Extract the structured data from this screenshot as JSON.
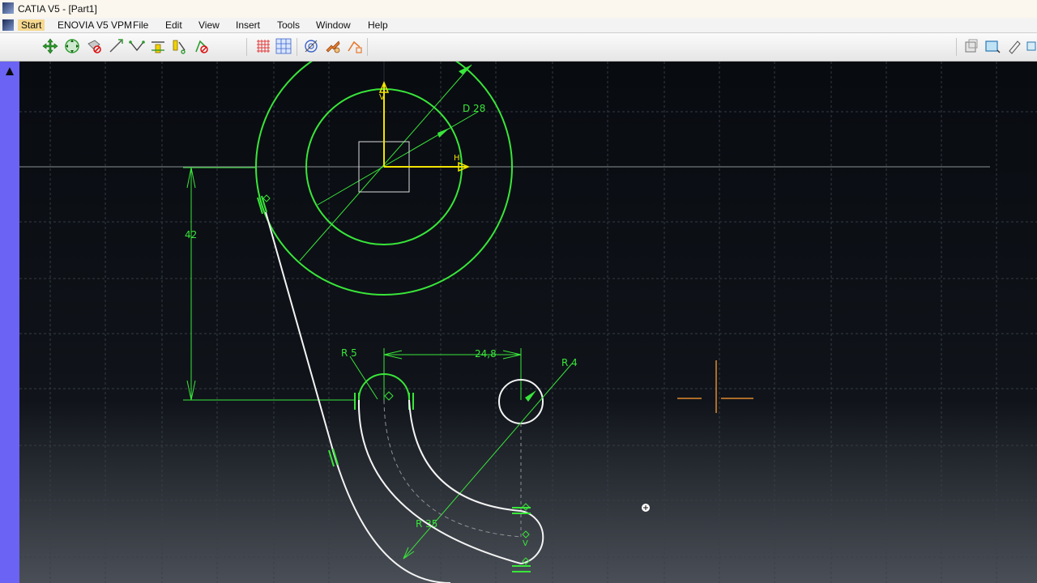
{
  "window": {
    "title": "CATIA V5 - [Part1]"
  },
  "menu": [
    {
      "label": "Start",
      "active": true
    },
    {
      "label": "ENOVIA V5 VPM"
    },
    {
      "label": "File"
    },
    {
      "label": "Edit"
    },
    {
      "label": "View"
    },
    {
      "label": "Insert"
    },
    {
      "label": "Tools"
    },
    {
      "label": "Window"
    },
    {
      "label": "Help"
    }
  ],
  "toolbar": {
    "icons": [
      "pan-icon",
      "rotate-icon",
      "no-show-icon",
      "line-tool-icon",
      "profile-icon",
      "constraint-icon",
      "snap-icon",
      "grid-icon",
      "snap-to-point-icon",
      "sketch-analysis-icon",
      "dimension-icon",
      "tool-icon",
      "right-view-icon",
      "right-select-icon",
      "right-edit-icon",
      "right-more-icon"
    ]
  },
  "sketch": {
    "labels": {
      "diameter": "D 28",
      "height": "42",
      "r5": "R 5",
      "horizontal": "24,8",
      "r4": "R 4",
      "r35": "R 35",
      "h_axis": "H",
      "v_axis": "V"
    },
    "colors": {
      "constraint": "#39e63a",
      "geometry": "#f4f4f4",
      "axis": "#f1e400",
      "cursor": "#e08a2c",
      "grid": "#3a4048"
    }
  }
}
